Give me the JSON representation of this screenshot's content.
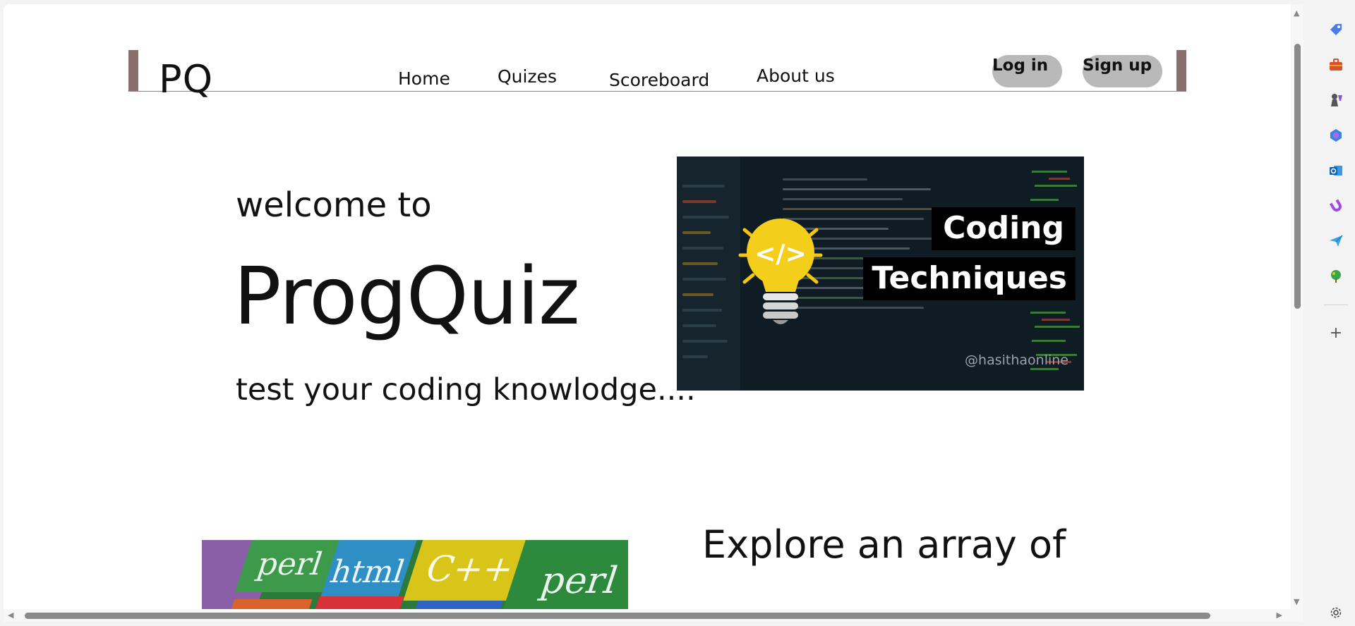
{
  "navbar": {
    "logo": "PQ",
    "links": [
      "Home",
      "Quizes",
      "Scoreboard",
      "About us"
    ],
    "login_label": "Log in",
    "signup_label": "Sign up"
  },
  "hero": {
    "welcome": "welcome to",
    "title": "ProgQuiz",
    "tagline": "test your coding knowlodge....",
    "image": {
      "label_line1": "Coding",
      "label_line2": "Techniques",
      "watermark": "@hasithaonline"
    }
  },
  "explore": {
    "heading": "Explore an array of",
    "languages": [
      "perl",
      "html",
      "C++",
      "perl"
    ]
  },
  "sidebar_icons": [
    "tag-icon",
    "briefcase-icon",
    "chess-icon",
    "copilot-icon",
    "outlook-icon",
    "magnet-icon",
    "send-icon",
    "tree-icon",
    "add-icon",
    "settings-icon"
  ],
  "colors": {
    "nav_accent": "#8a6e6e",
    "button_bg": "#b9b9b9",
    "text": "#111111"
  }
}
